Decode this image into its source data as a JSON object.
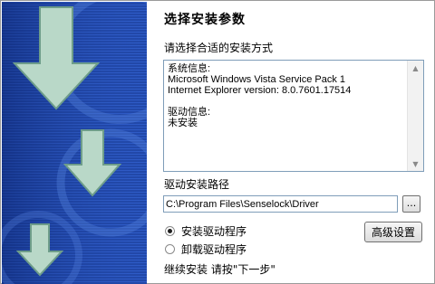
{
  "window": {
    "heading": "选择安装参数"
  },
  "prompt": "请选择合适的安装方式",
  "info_box": {
    "text": "系统信息:\nMicrosoft Windows Vista Service Pack 1\nInternet Explorer version: 8.0.7601.17514\n\n驱动信息:\n未安装"
  },
  "install_path": {
    "label": "驱动安装路径",
    "value": "C:\\Program Files\\Senselock\\Driver",
    "browse_label": "..."
  },
  "options": {
    "install": {
      "label": "安装驱动程序",
      "checked": true
    },
    "uninstall": {
      "label": "卸载驱动程序",
      "checked": false
    }
  },
  "advanced_button": "高级设置",
  "footer_text": "继续安装 请按\"下一步\"",
  "colors": {
    "banner_blue": "#1b3f9e",
    "arrow_fill": "#b9d8c8"
  }
}
